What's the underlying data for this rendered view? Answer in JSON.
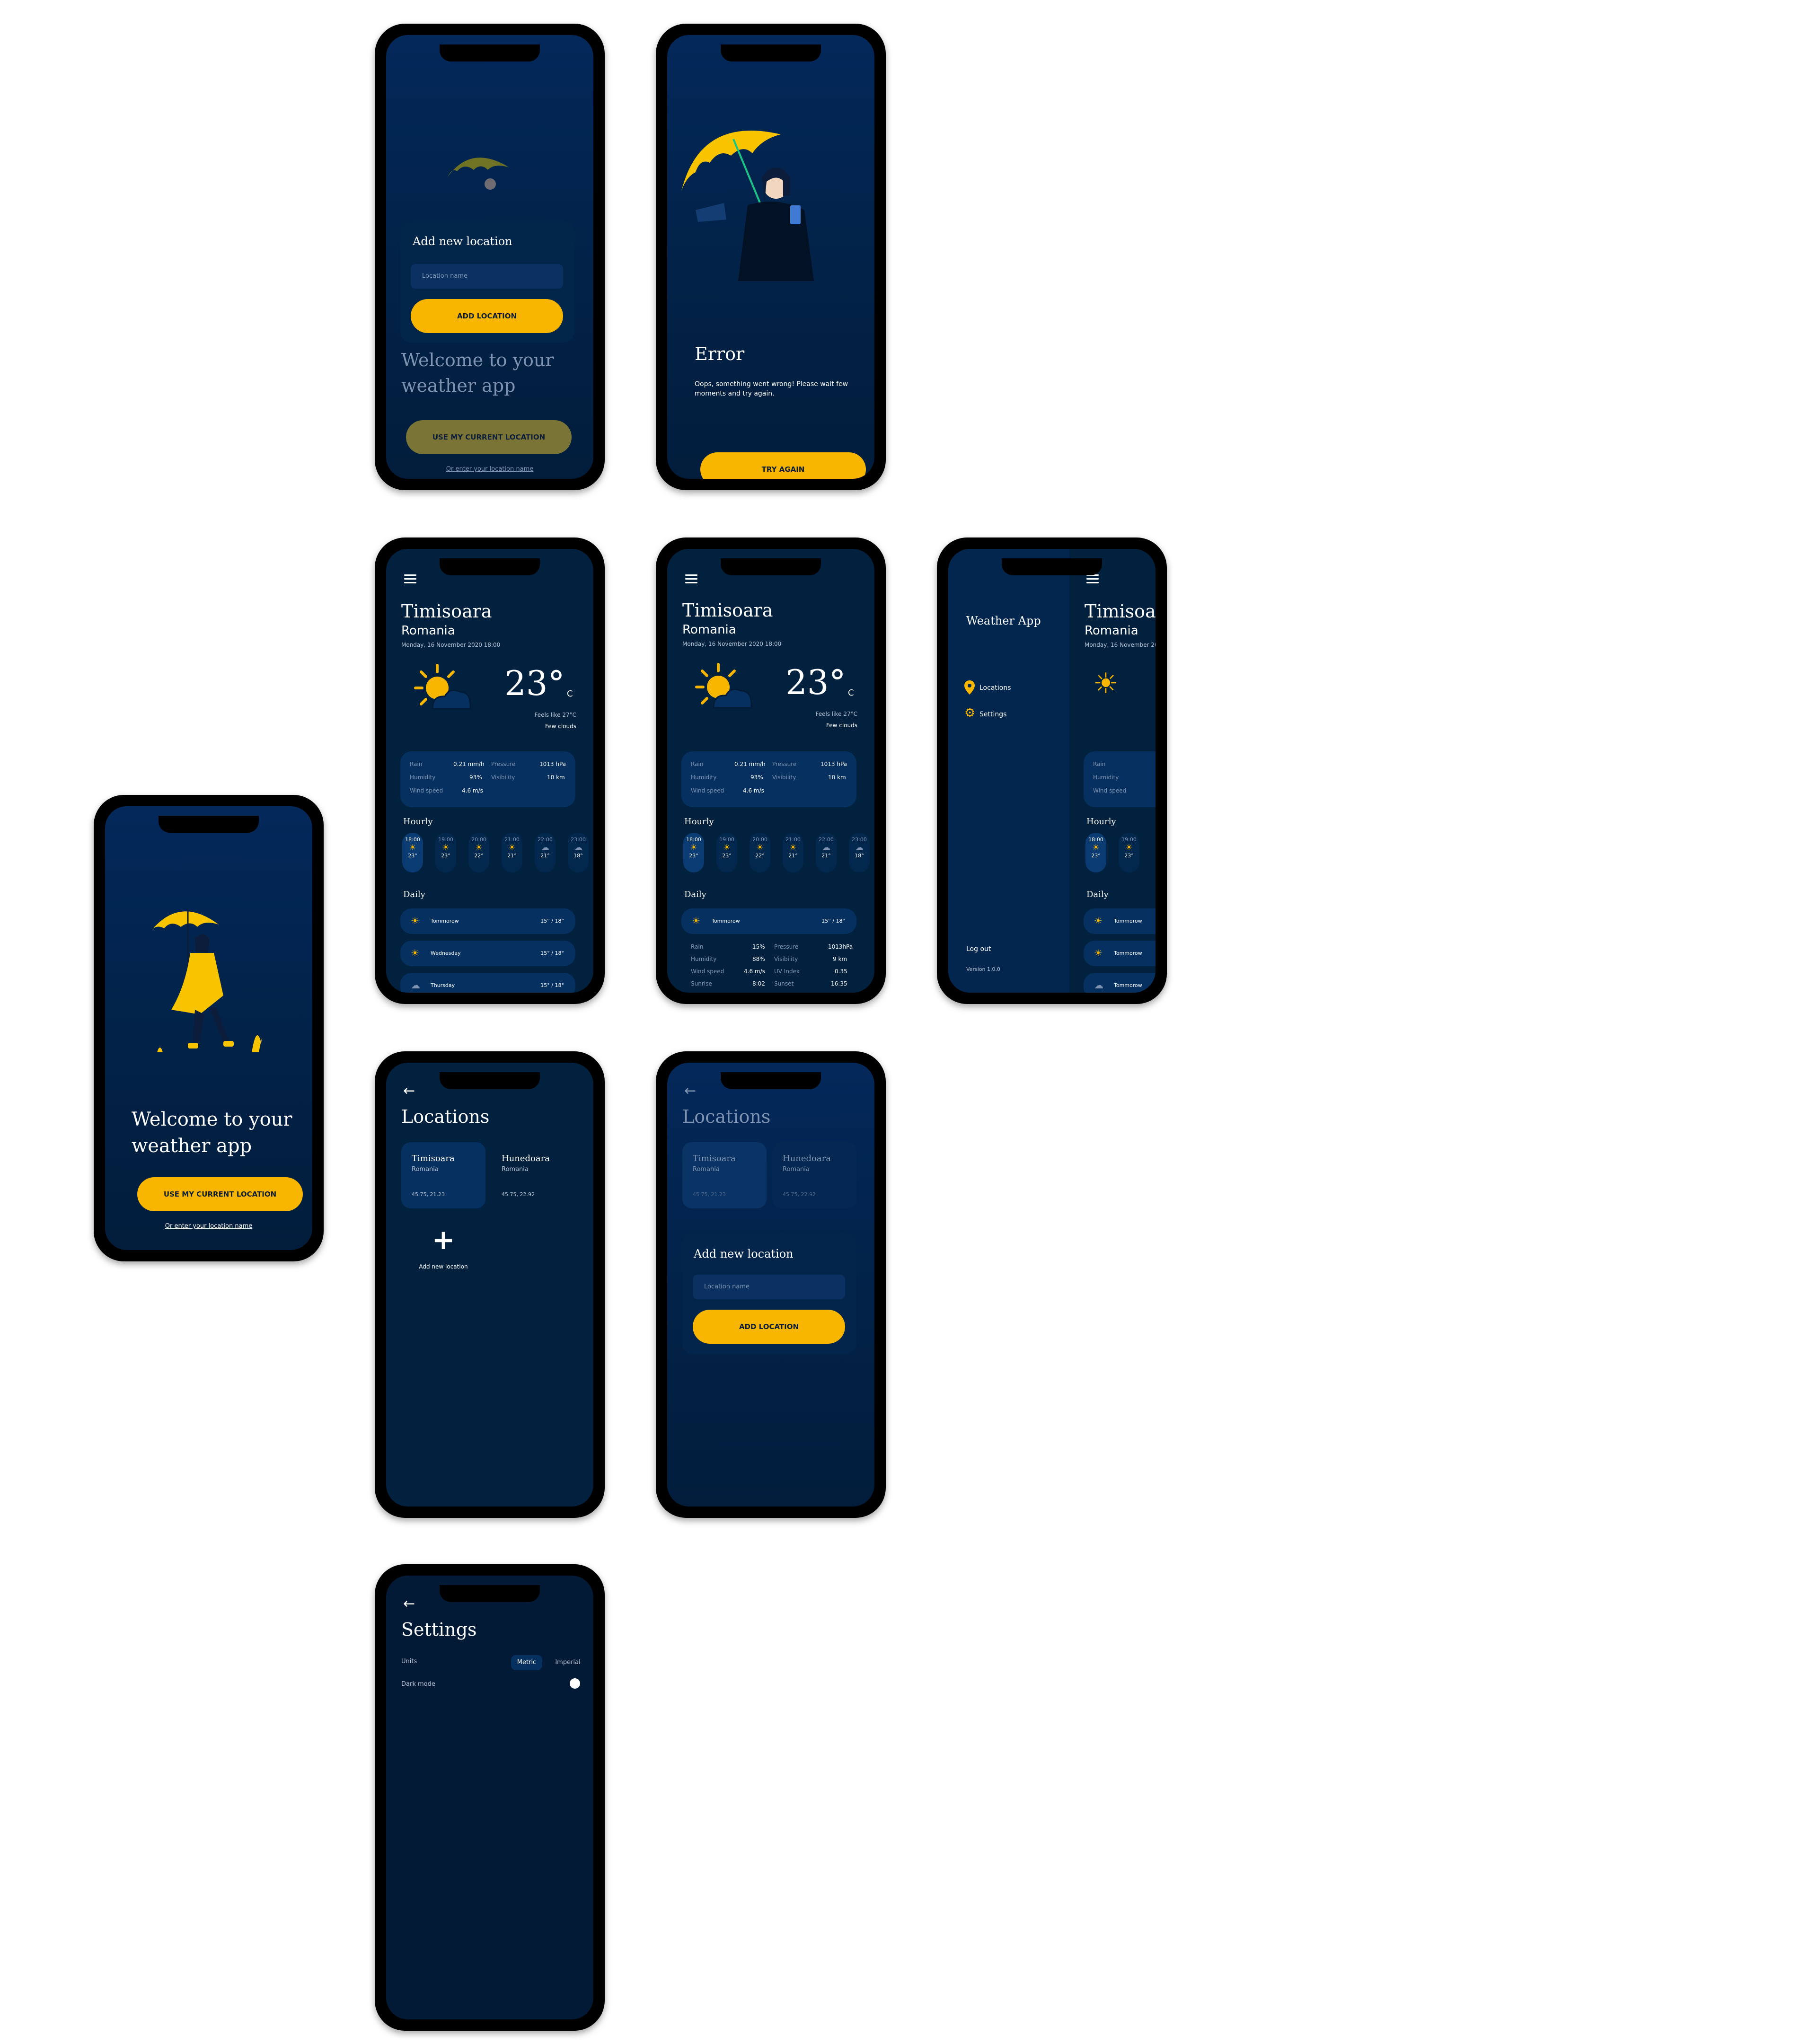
{
  "colors": {
    "accent": "#f8b600",
    "screen_bg": "#01213f",
    "card": "#05305f"
  },
  "onboarding": {
    "title_line1": "Welcome to your",
    "title_line2": "weather app",
    "primary_button": "USE MY CURRENT LOCATION",
    "link": "Or enter your location name"
  },
  "add_location_dialog": {
    "title": "Add new location",
    "placeholder": "Location name",
    "button": "ADD LOCATION"
  },
  "error": {
    "title": "Error",
    "message_line1": "Oops, something went wrong! Please wait few",
    "message_line2": "moments and try again.",
    "button": "TRY AGAIN"
  },
  "weather": {
    "city": "Timisoara",
    "country": "Romania",
    "datetime": "Monday, 16 November 2020 18:00",
    "temp": "23°",
    "unit": "C",
    "feels_like": "Feels like 27°C",
    "condition": "Few clouds",
    "stats": {
      "rain_label": "Rain",
      "rain": "0.21 mm/h",
      "pressure_label": "Pressure",
      "pressure": "1013 hPa",
      "humidity_label": "Humidity",
      "humidity": "93%",
      "visibility_label": "Visibility",
      "visibility": "10 km",
      "wind_label": "Wind speed",
      "wind": "4.6 m/s"
    },
    "hourly_title": "Hourly",
    "hourly": [
      {
        "time": "18:00",
        "temp": "23°",
        "icon": "sun-cloud-icon"
      },
      {
        "time": "19:00",
        "temp": "23°",
        "icon": "sun-icon"
      },
      {
        "time": "20:00",
        "temp": "22°",
        "icon": "sun-icon"
      },
      {
        "time": "21:00",
        "temp": "21°",
        "icon": "sun-cloud-icon"
      },
      {
        "time": "22:00",
        "temp": "21°",
        "icon": "moon-cloud-icon"
      },
      {
        "time": "23:00",
        "temp": "18°",
        "icon": "moon-cloud-icon"
      }
    ],
    "daily_title": "Daily",
    "daily": [
      {
        "day": "Tommorow",
        "temp": "15° / 18°",
        "icon": "sun-icon"
      },
      {
        "day": "Wednesday",
        "temp": "15° / 18°",
        "icon": "sun-cloud-icon"
      },
      {
        "day": "Thursday",
        "temp": "15° / 18°",
        "icon": "moon-cloud-icon"
      }
    ],
    "expanded": {
      "rain_label": "Rain",
      "rain": "15%",
      "pressure_label": "Pressure",
      "pressure": "1013hPa",
      "humidity_label": "Humidity",
      "humidity": "88%",
      "visibility_label": "Visibility",
      "visibility": "9 km",
      "wind_label": "Wind speed",
      "wind": "4.6 m/s",
      "uv_label": "UV Index",
      "uv": "0.35",
      "sunrise_label": "Sunrise",
      "sunrise": "8:02",
      "sunset_label": "Sunset",
      "sunset": "16:35"
    }
  },
  "drawer": {
    "title": "Weather App",
    "items": [
      {
        "label": "Locations",
        "icon": "pin-icon"
      },
      {
        "label": "Settings",
        "icon": "gear-icon"
      }
    ],
    "logout": "Log out",
    "version": "Version 1.0.0"
  },
  "locations": {
    "title": "Locations",
    "add_label": "Add new location",
    "items": [
      {
        "city": "Timisoara",
        "country": "Romania",
        "coords": "45.75, 21.23"
      },
      {
        "city": "Hunedoara",
        "country": "Romania",
        "coords": "45.75, 22.92"
      }
    ]
  },
  "settings": {
    "title": "Settings",
    "units_label": "Units",
    "metric": "Metric",
    "imperial": "Imperial",
    "dark_mode_label": "Dark mode"
  }
}
